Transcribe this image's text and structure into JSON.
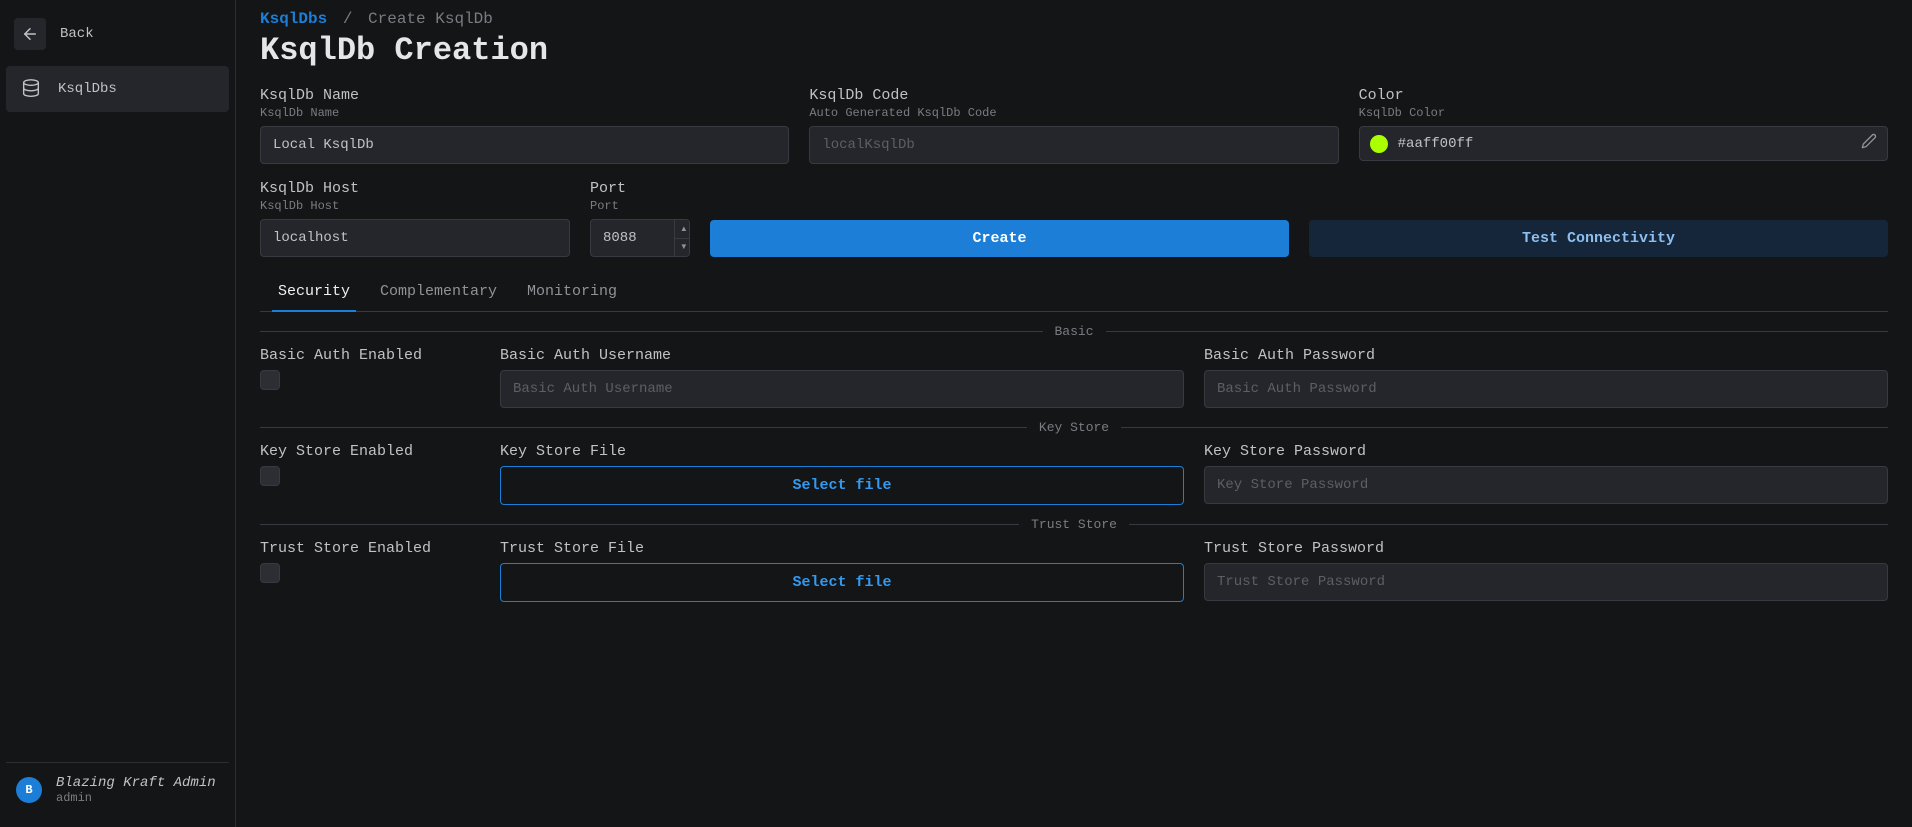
{
  "sidebar": {
    "back_label": "Back",
    "items": [
      {
        "label": "KsqlDbs"
      }
    ]
  },
  "user": {
    "avatar_letter": "B",
    "display_name": "Blazing Kraft Admin",
    "username": "admin"
  },
  "breadcrumb": {
    "parent": "KsqlDbs",
    "sep": "/",
    "current": "Create KsqlDb"
  },
  "page_title": "KsqlDb Creation",
  "form": {
    "name": {
      "label": "KsqlDb Name",
      "sublabel": "KsqlDb Name",
      "value": "Local KsqlDb"
    },
    "code": {
      "label": "KsqlDb Code",
      "sublabel": "Auto Generated KsqlDb Code",
      "placeholder": "localKsqlDb"
    },
    "color": {
      "label": "Color",
      "sublabel": "KsqlDb Color",
      "value": "#aaff00ff",
      "swatch": "#aaff00"
    },
    "host": {
      "label": "KsqlDb Host",
      "sublabel": "KsqlDb Host",
      "value": "localhost"
    },
    "port": {
      "label": "Port",
      "sublabel": "Port",
      "value": "8088"
    },
    "create_label": "Create",
    "test_label": "Test Connectivity"
  },
  "tabs": [
    {
      "label": "Security",
      "active": true
    },
    {
      "label": "Complementary",
      "active": false
    },
    {
      "label": "Monitoring",
      "active": false
    }
  ],
  "security": {
    "basic": {
      "title": "Basic",
      "enabled_label": "Basic Auth Enabled",
      "username_label": "Basic Auth Username",
      "username_placeholder": "Basic Auth Username",
      "password_label": "Basic Auth Password",
      "password_placeholder": "Basic Auth Password"
    },
    "keystore": {
      "title": "Key Store",
      "enabled_label": "Key Store Enabled",
      "file_label": "Key Store File",
      "file_button": "Select file",
      "password_label": "Key Store Password",
      "password_placeholder": "Key Store Password"
    },
    "truststore": {
      "title": "Trust Store",
      "enabled_label": "Trust Store Enabled",
      "file_label": "Trust Store File",
      "file_button": "Select file",
      "password_label": "Trust Store Password",
      "password_placeholder": "Trust Store Password"
    }
  }
}
